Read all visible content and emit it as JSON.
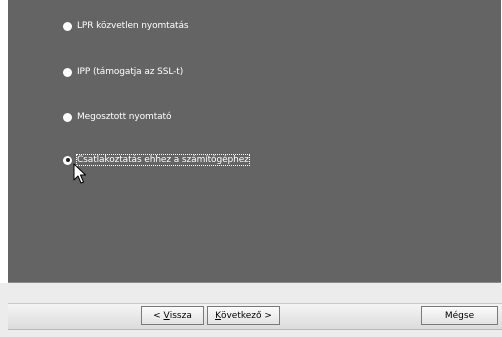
{
  "options": [
    {
      "label": "LPR közvetlen nyomtatás",
      "checked": false
    },
    {
      "label": "IPP (támogatja az SSL-t)",
      "checked": false
    },
    {
      "label": "Megosztott nyomtató",
      "checked": false
    },
    {
      "label": "Csatlakoztatás ehhez a számítógéphez",
      "checked": true
    }
  ],
  "buttons": {
    "back": {
      "prefix": "< ",
      "accel": "V",
      "rest": "issza"
    },
    "next": {
      "accel": "K",
      "rest": "övetkező >"
    },
    "cancel": {
      "label": "Mégse"
    }
  },
  "colors": {
    "panel": "#646464",
    "option_text": "#ffffff",
    "button_bar": "#ececec"
  },
  "icons": {
    "cursor": "mouse-pointer-icon"
  }
}
